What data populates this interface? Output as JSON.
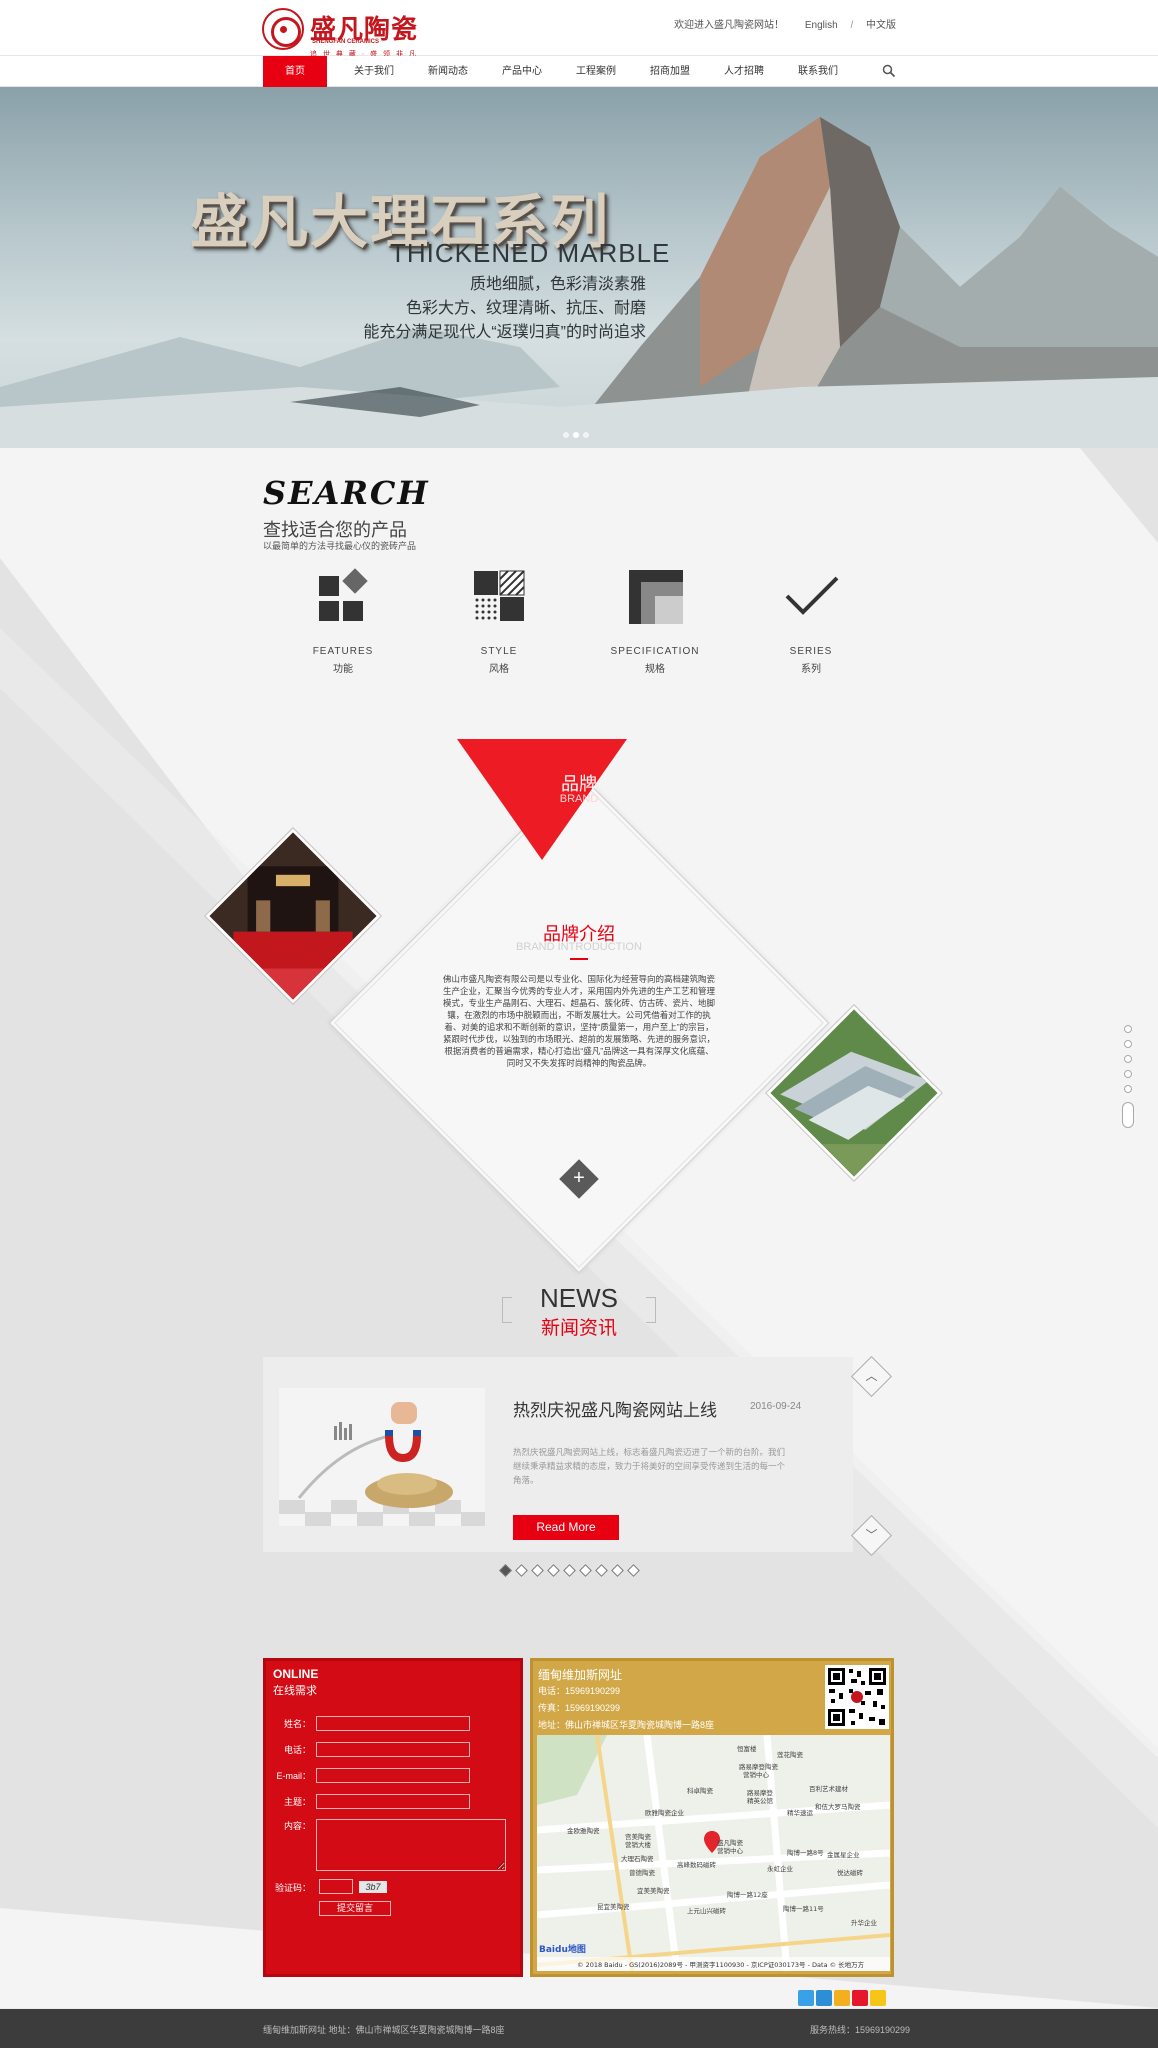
{
  "header": {
    "logo_name": "盛凡陶瓷",
    "logo_en": "SHENGFAN CERAMICS",
    "logo_slogan": "追 世 典 藏 · 盛 领 非 凡",
    "welcome": "欢迎进入盛凡陶瓷网站！",
    "lang_en": "English",
    "lang_sep": "/",
    "lang_cn": "中文版"
  },
  "nav": {
    "items": [
      "首页",
      "关于我们",
      "新闻动态",
      "产品中心",
      "工程案例",
      "招商加盟",
      "人才招聘",
      "联系我们"
    ],
    "active_index": 0,
    "search_icon": "search-icon"
  },
  "banner": {
    "title": "盛凡大理石系列",
    "subtitle": "THICKENED MARBLE",
    "line1": "质地细腻，色彩清淡素雅",
    "line2": "色彩大方、纹理清晰、抗压、耐磨",
    "line3": "能充分满足现代人“返璞归真”的时尚追求",
    "slides": 3,
    "active_slide": 1
  },
  "search": {
    "title_en": "SEARCH",
    "title_cn": "查找适合您的产品",
    "desc": "以最简单的方法寻找最心仪的瓷砖产品",
    "items": [
      {
        "en": "FEATURES",
        "cn": "功能",
        "icon": "features-icon"
      },
      {
        "en": "STYLE",
        "cn": "风格",
        "icon": "style-icon"
      },
      {
        "en": "SPECIFICATION",
        "cn": "规格",
        "icon": "specification-icon"
      },
      {
        "en": "SERIES",
        "cn": "系列",
        "icon": "series-icon"
      }
    ]
  },
  "brand": {
    "badge_cn": "品牌",
    "badge_en": "BRAND",
    "title_cn": "品牌介绍",
    "title_en": "BRAND INTRODUCTION",
    "text": "佛山市盛凡陶瓷有限公司是以专业化、国际化为经营导向的高档建筑陶瓷生产企业，汇聚当今优秀的专业人才，采用国内外先进的生产工艺和管理模式，专业生产晶刚石、大理石、超晶石、簇化砖、仿古砖、瓷片、地脚镶，在激烈的市场中脱颖而出，不断发展壮大。公司凭借着对工作的执着、对美的追求和不断创新的意识，坚持“质量第一，用户至上”的宗旨，紧跟时代步伐，以独到的市场眼光、超前的发展策略、先进的服务意识，根据消费者的普遍需求，精心打造出“盛凡”品牌这一具有深厚文化底蕴、同时又不失发挥时尚精神的陶瓷品牌。",
    "more_icon": "plus-icon"
  },
  "news": {
    "title_en": "NEWS",
    "title_cn": "新闻资讯",
    "item": {
      "title": "热烈庆祝盛凡陶瓷网站上线",
      "date": "2016-09-24",
      "summary": "热烈庆祝盛凡陶瓷网站上线，标志着盛凡陶瓷迈进了一个新的台阶。我们继续秉承精益求精的态度，致力于将美好的空间享受传递到生活的每一个角落。",
      "more": "Read More"
    },
    "pages": 9,
    "active_page": 0
  },
  "online": {
    "title_en": "ONLINE",
    "title_cn": "在线需求",
    "fields": [
      "姓名：",
      "电话：",
      "E-mail：",
      "主题："
    ],
    "content_label": "内容：",
    "captcha_label": "验证码：",
    "captcha_text": "3b7",
    "submit": "提交留言"
  },
  "company": {
    "name": "缅甸维加斯网址",
    "phone": "电话：15969190299",
    "fax": "传真：15969190299",
    "address": "地址：佛山市禅城区华夏陶瓷城陶博一路8座",
    "map_labels": [
      "恒富楼",
      "路易摩登陶瓷营销中心",
      "科卓陶瓷",
      "路易摩登精英公馆",
      "莲花陶瓷",
      "百利艺术建材",
      "欧雅陶瓷企业",
      "精华速运",
      "和伍大罗马陶瓷",
      "金欧雅陶瓷",
      "盛凡陶瓷营销中心",
      "宫美陶瓷营销大楼",
      "陶博一路8号",
      "大理石陶瓷",
      "高峰数码磁砖",
      "金属星企业",
      "永虹企业",
      "曾德陶瓷",
      "悦达磁砖",
      "宜美美陶瓷",
      "陶博一路12座",
      "上元山兴磁砖",
      "昆宜美陶瓷",
      "陶博一路11号",
      "升华企业"
    ],
    "map_copyright": "© 2018 Baidu - GS(2016)2089号 - 甲测资字1100930 - 京ICP证030173号 - Data © 长地万方",
    "map_brand": "Baidu地图"
  },
  "share_icons": [
    "share-plus-icon",
    "qq-icon",
    "qzone-icon",
    "weibo-icon",
    "favorite-icon"
  ],
  "side_nav": 6,
  "footer": {
    "left": "缅甸维加斯网址        地址：佛山市禅城区华夏陶瓷城陶博一路8座",
    "right": "服务热线：15969190299"
  },
  "colors": {
    "brand_red": "#e60012",
    "form_red": "#d30b14",
    "gold": "#d1a747",
    "footer": "#3c3c3c"
  }
}
